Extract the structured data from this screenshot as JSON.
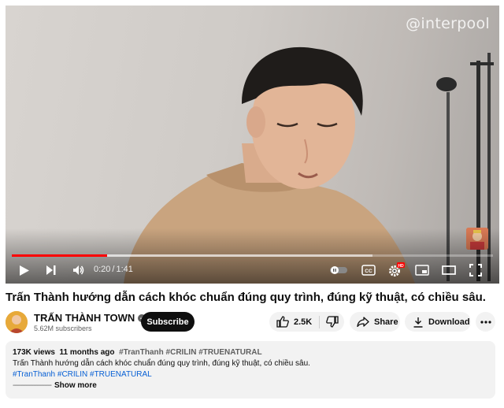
{
  "player": {
    "watermark": "@interpool",
    "current_time": "0:20",
    "separator": "/",
    "duration": "1:41",
    "progress_fraction": 0.198,
    "buffered_fraction": 0.75,
    "hd_badge": "HD",
    "cc_label": "CC"
  },
  "video": {
    "title": "Trấn Thành hướng dẫn cách khóc chuẩn đúng quy trình, đúng kỹ thuật, có chiều sâu."
  },
  "channel": {
    "name": "TRẤN THÀNH TOWN",
    "subscribers": "5.62M subscribers",
    "subscribe_label": "Subscribe"
  },
  "actions": {
    "like_count": "2.5K",
    "share_label": "Share",
    "download_label": "Download"
  },
  "description": {
    "views": "173K views",
    "age": "11 months ago",
    "header_tags": "#TranThanh #CRILIN #TRUENATURAL",
    "text": "Trấn Thành hướng dẫn cách khóc chuẩn đúng quy trình, đúng kỹ thuật, có chiều sâu.",
    "link_tags": "#TranThanh #CRILIN #TRUENATURAL",
    "dots": "---------------------",
    "show_more": "Show more"
  },
  "colors": {
    "progress": "#ff0000",
    "subscribe_bg": "#0f0f0f",
    "pill_bg": "#f2f2f2",
    "link": "#065fd4"
  }
}
